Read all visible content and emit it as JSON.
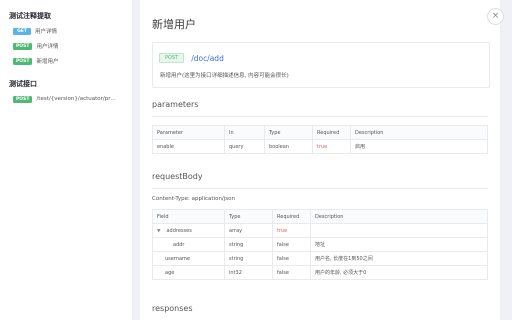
{
  "sidebar": {
    "groups": [
      {
        "title": "测试注释提取",
        "items": [
          {
            "method": "GET",
            "label": "用户详情"
          },
          {
            "method": "POST",
            "label": "用户详情"
          },
          {
            "method": "POST",
            "label": "新增用户"
          }
        ]
      },
      {
        "title": "测试接口",
        "items": [
          {
            "method": "POST",
            "label": "/test/{version}/actuator/prom..."
          }
        ]
      }
    ]
  },
  "detail": {
    "title": "新增用户",
    "method": "POST",
    "path": "/doc/add",
    "description": "新增用户(这里为接口详细描述信息, 内容可能会很长)",
    "close_glyph": "×"
  },
  "parameters": {
    "title": "parameters",
    "headers": [
      "Parameter",
      "In",
      "Type",
      "Required",
      "Description"
    ],
    "rows": [
      [
        "enable",
        "query",
        "boolean",
        "true",
        "启用"
      ]
    ]
  },
  "requestBody": {
    "title": "requestBody",
    "content_type": "Content-Type: application/json",
    "headers": [
      "Field",
      "Type",
      "Required",
      "Description"
    ],
    "rows": [
      [
        "addresses",
        "array",
        "true",
        ""
      ],
      [
        "addr",
        "string",
        "false",
        "地址"
      ],
      [
        "username",
        "string",
        "false",
        "用户名, 长度在1到50之间"
      ],
      [
        "age",
        "int32",
        "false",
        "用户的年龄, 必须大于0"
      ]
    ]
  },
  "responses": {
    "title": "responses"
  },
  "colors": {
    "get": "#5bb4e5",
    "post": "#4fb874",
    "path": "#3a6fd8",
    "required_true": "#e85d5d"
  }
}
